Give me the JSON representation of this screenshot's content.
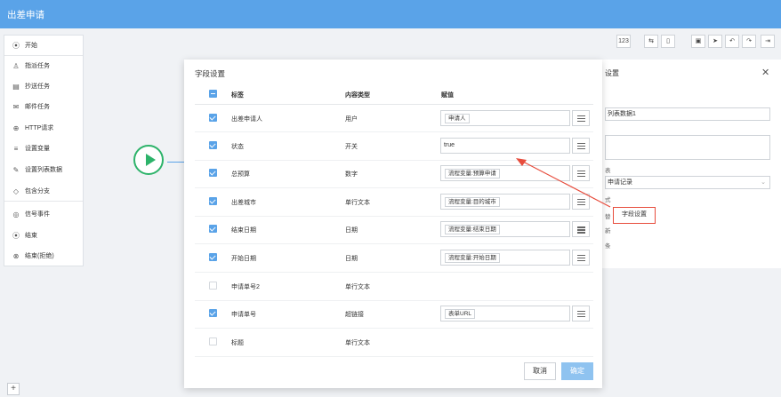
{
  "app": {
    "title": "出差申请"
  },
  "sidebar": {
    "items": [
      {
        "label": "开始",
        "icon": "play-circle-icon",
        "glyph": "⦿"
      },
      {
        "label": "指派任务",
        "icon": "users-icon",
        "glyph": "♙"
      },
      {
        "label": "抄送任务",
        "icon": "document-icon",
        "glyph": "▤"
      },
      {
        "label": "邮件任务",
        "icon": "mail-icon",
        "glyph": "✉"
      },
      {
        "label": "HTTP请求",
        "icon": "globe-icon",
        "glyph": "⊕"
      },
      {
        "label": "设置变量",
        "icon": "variable-icon",
        "glyph": "≡"
      },
      {
        "label": "设置列表数据",
        "icon": "edit-icon",
        "glyph": "✎"
      },
      {
        "label": "包含分支",
        "icon": "diamond-icon",
        "glyph": "◇"
      },
      {
        "label": "信号事件",
        "icon": "signal-icon",
        "glyph": "◎"
      },
      {
        "label": "结束",
        "icon": "end-icon",
        "glyph": "⦿"
      },
      {
        "label": "结束(拒绝)",
        "icon": "reject-icon",
        "glyph": "⊗"
      }
    ]
  },
  "toolbar": {
    "count_label": "123"
  },
  "right_panel": {
    "title": "设置",
    "name_value": "列表数据1",
    "label_form": "表",
    "form_value": "申请记录",
    "label_mode": "式",
    "label_1": "替",
    "label_2": "新",
    "label_3": "条",
    "field_settings_button": "字段设置"
  },
  "modal": {
    "title": "字段设置",
    "headers": {
      "label": "标签",
      "type": "内容类型",
      "value": "赋值"
    },
    "rows": [
      {
        "label": "出差申请人",
        "type": "用户",
        "value": "申请人",
        "checked": true,
        "has_value": true,
        "tag": true
      },
      {
        "label": "状态",
        "type": "开关",
        "value": "true",
        "checked": true,
        "has_value": true,
        "tag": false
      },
      {
        "label": "总预算",
        "type": "数字",
        "value": "流程变量:预算申请",
        "checked": true,
        "has_value": true,
        "tag": true
      },
      {
        "label": "出差城市",
        "type": "单行文本",
        "value": "流程变量:目的城市",
        "checked": true,
        "has_value": true,
        "tag": true
      },
      {
        "label": "结束日期",
        "type": "日期",
        "value": "流程变量:结束日期",
        "checked": true,
        "has_value": true,
        "tag": true
      },
      {
        "label": "开始日期",
        "type": "日期",
        "value": "流程变量:开始日期",
        "checked": true,
        "has_value": true,
        "tag": true
      },
      {
        "label": "申请单号2",
        "type": "单行文本",
        "value": "",
        "checked": false,
        "has_value": false,
        "tag": false
      },
      {
        "label": "申请单号",
        "type": "超链接",
        "value": "表单URL",
        "checked": true,
        "has_value": true,
        "tag": true
      },
      {
        "label": "标题",
        "type": "单行文本",
        "value": "",
        "checked": false,
        "has_value": false,
        "tag": false
      }
    ],
    "cancel_label": "取消",
    "ok_label": "确定"
  },
  "colors": {
    "topbar": "#5aa3e8",
    "accent": "#5aa3e8",
    "start": "#2db36a",
    "highlight": "#e74c3c"
  }
}
